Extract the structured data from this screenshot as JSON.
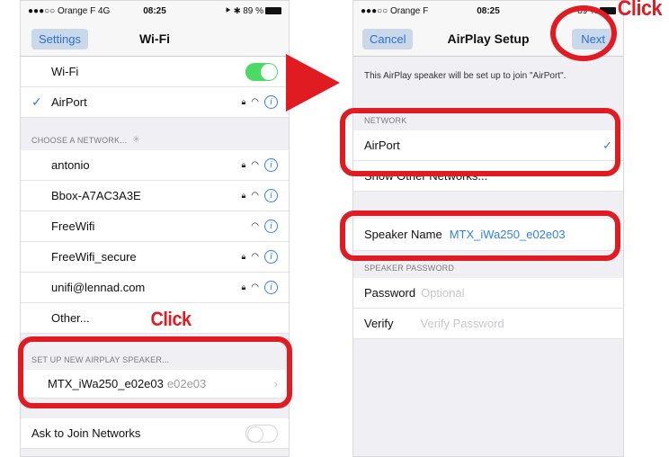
{
  "left": {
    "status": {
      "carrier": "●●●○○ Orange F  4G",
      "time": "08:25",
      "battery": "⯈ ✱ 89 %"
    },
    "nav": {
      "back": "Settings",
      "title": "Wi-Fi"
    },
    "wifi_row": {
      "label": "Wi-Fi"
    },
    "current_network": {
      "label": "AirPort"
    },
    "choose_header": "CHOOSE A NETWORK...",
    "networks": [
      {
        "name": "antonio"
      },
      {
        "name": "Bbox-A7AC3A3E"
      },
      {
        "name": "FreeWifi"
      },
      {
        "name": "FreeWifi_secure"
      },
      {
        "name": "unifi@lennad.com"
      },
      {
        "name": "Other..."
      }
    ],
    "airplay_header": "SET UP NEW AIRPLAY SPEAKER...",
    "speaker": {
      "name": "MTX_iWa250_e02e03",
      "suffix": "e02e03"
    },
    "ask_row": {
      "label": "Ask to Join Networks"
    },
    "click_label": "Click"
  },
  "right": {
    "status": {
      "carrier": "●●●○○ Orange F",
      "time": "08:25",
      "battery": "89 %"
    },
    "nav": {
      "cancel": "Cancel",
      "title": "AirPlay Setup",
      "next": "Next"
    },
    "intro": "This AirPlay speaker will be set up to join \"AirPort\".",
    "network_header": "NETWORK",
    "network_selected": "AirPort",
    "show_other": "Show Other Networks...",
    "speaker_name": {
      "label": "Speaker Name",
      "value": "MTX_iWa250_e02e03"
    },
    "password_header": "SPEAKER PASSWORD",
    "password": {
      "label": "Password",
      "placeholder": "Optional"
    },
    "verify": {
      "label": "Verify",
      "placeholder": "Verify Password"
    },
    "click_label": "Click"
  },
  "colors": {
    "annotation_red": "#e01b22",
    "ios_blue": "#2f80ed",
    "toggle_green": "#4cd964"
  }
}
